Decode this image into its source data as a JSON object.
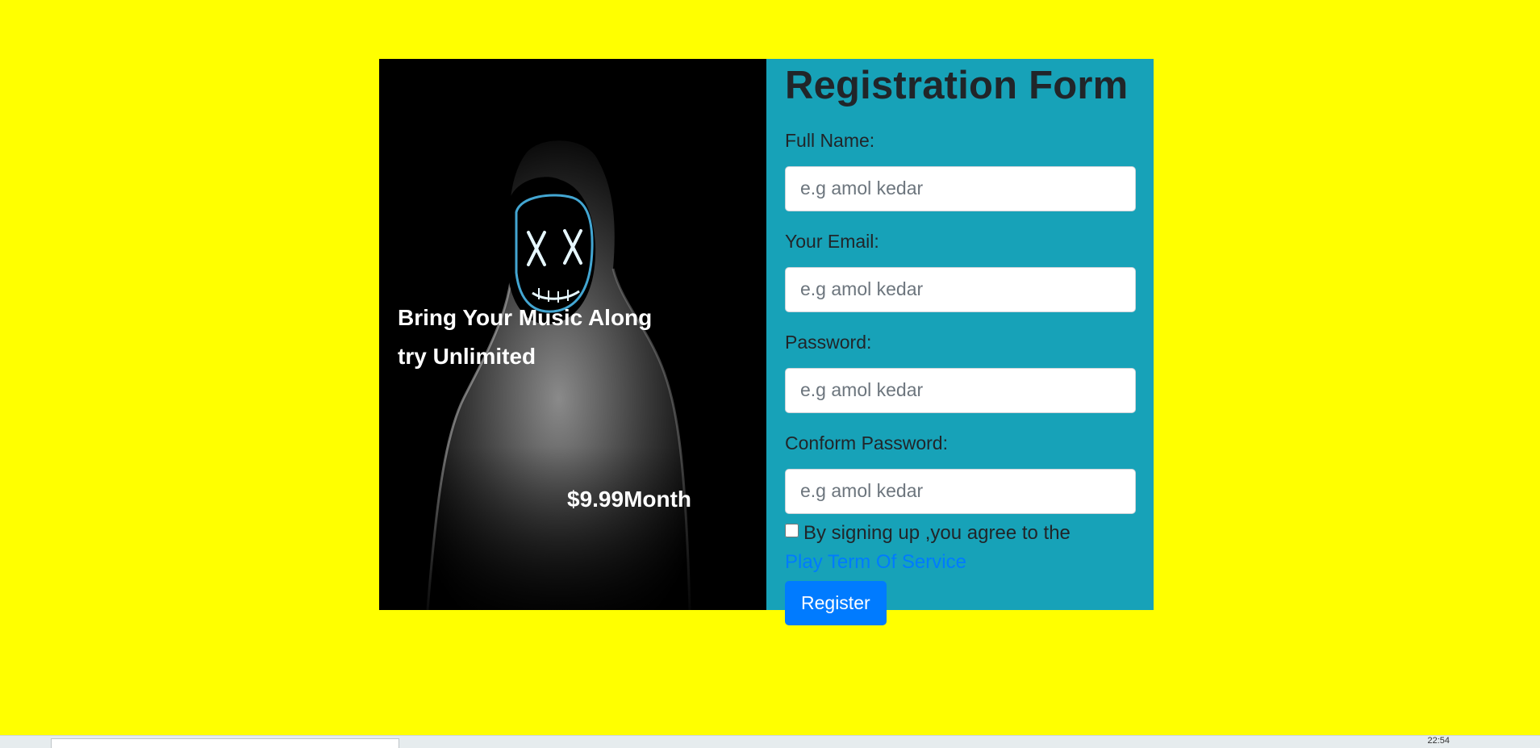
{
  "promo": {
    "tagline_line1": "Bring Your Music Along",
    "tagline_line2": "try Unlimited",
    "price": "$9.99Month"
  },
  "form": {
    "title": "Registration Form",
    "fields": [
      {
        "label": "Full Name:",
        "placeholder": "e.g amol kedar"
      },
      {
        "label": "Your Email:",
        "placeholder": "e.g amol kedar"
      },
      {
        "label": "Password:",
        "placeholder": "e.g amol kedar"
      },
      {
        "label": "Conform Password:",
        "placeholder": "e.g amol kedar"
      }
    ],
    "terms_text": "By signing up ,you agree to the",
    "terms_link": "Play Term Of Service",
    "register_label": "Register"
  },
  "taskbar": {
    "clock": "22:54"
  },
  "colors": {
    "page_background": "#ffff00",
    "form_panel": "#17a2b8",
    "primary": "#007bff"
  }
}
